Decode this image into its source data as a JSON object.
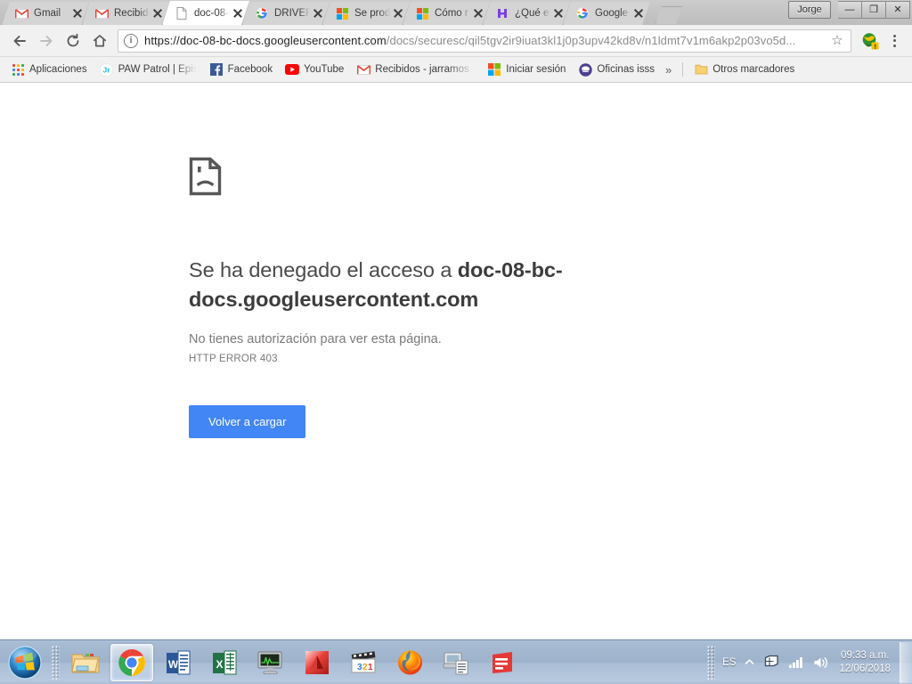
{
  "window": {
    "profile_button": "Jorge",
    "minimize": "–",
    "restore": "❐",
    "close": "✕"
  },
  "tabs": [
    {
      "title": "Gmail",
      "favicon": "gmail-icon",
      "active": false
    },
    {
      "title": "Recibidos",
      "favicon": "gmail-icon",
      "active": false
    },
    {
      "title": "doc-08-",
      "favicon": "document-icon",
      "active": true
    },
    {
      "title": "DRIVER",
      "favicon": "google-icon",
      "active": false
    },
    {
      "title": "Se prod",
      "favicon": "microsoft-icon",
      "active": false
    },
    {
      "title": "Cómo r",
      "favicon": "microsoft-icon",
      "active": false
    },
    {
      "title": "¿Qué es",
      "favicon": "purple-h-icon",
      "active": false
    },
    {
      "title": "Google",
      "favicon": "google-icon",
      "active": false
    }
  ],
  "toolbar": {
    "back_icon": "back-arrow-icon",
    "forward_icon": "forward-arrow-icon",
    "reload_icon": "reload-icon",
    "home_icon": "home-icon",
    "info_icon": "info-icon",
    "url_host": "https://doc-08-bc-docs.googleusercontent.com",
    "url_path": "/docs/securesc/qil5tgv2ir9iuat3kl1j0p3upv42kd8v/n1ldmt7v1m6akp2p03vo5d...",
    "star_icon": "bookmark-star-icon",
    "extension_icon": "extension-globe-icon",
    "menu_icon": "three-dot-menu-icon"
  },
  "bookmarks": {
    "apps_label": "Aplicaciones",
    "apps_icon": "apps-grid-icon",
    "items": [
      {
        "label": "PAW Patrol | Episodi",
        "icon": "jr-icon",
        "fade": true
      },
      {
        "label": "Facebook",
        "icon": "facebook-icon",
        "fade": false
      },
      {
        "label": "YouTube",
        "icon": "youtube-icon",
        "fade": false
      },
      {
        "label": "Recibidos - jarramos",
        "icon": "gmail-icon",
        "fade": true
      },
      {
        "label": "Iniciar sesión",
        "icon": "microsoft-icon",
        "fade": false
      },
      {
        "label": "Oficinas isss",
        "icon": "isss-icon",
        "fade": false
      }
    ],
    "overflow_label": "»",
    "other_bookmarks": {
      "label": "Otros marcadores",
      "icon": "folder-icon"
    }
  },
  "page": {
    "icon": "sad-document-icon",
    "heading_prefix": "Se ha denegado el acceso a ",
    "heading_host": "doc-08-bc-docs.googleusercontent.com",
    "detail": "No tienes autorización para ver esta página.",
    "error_code": "HTTP ERROR 403",
    "reload_button": "Volver a cargar",
    "accent_color": "#4285f4"
  },
  "taskbar": {
    "start_icon": "windows-start-orb-icon",
    "apps": [
      {
        "name": "file-explorer-icon",
        "active": false
      },
      {
        "name": "google-chrome-icon",
        "active": true
      },
      {
        "name": "microsoft-word-icon",
        "active": false
      },
      {
        "name": "microsoft-excel-icon",
        "active": false
      },
      {
        "name": "system-monitor-icon",
        "active": false
      },
      {
        "name": "autocad-icon",
        "active": false
      },
      {
        "name": "media-player-classic-icon",
        "active": false
      },
      {
        "name": "mozilla-firefox-icon",
        "active": false
      },
      {
        "name": "scanner-icon",
        "active": false
      },
      {
        "name": "sketchup-icon",
        "active": false
      }
    ],
    "tray": {
      "language": "ES",
      "show_hidden_icon": "chevron-up-icon",
      "action_center_icon": "action-center-flag-icon",
      "network_icon": "network-signal-icon",
      "volume_icon": "volume-icon",
      "time": "09:33 a.m.",
      "date": "12/06/2018"
    }
  }
}
